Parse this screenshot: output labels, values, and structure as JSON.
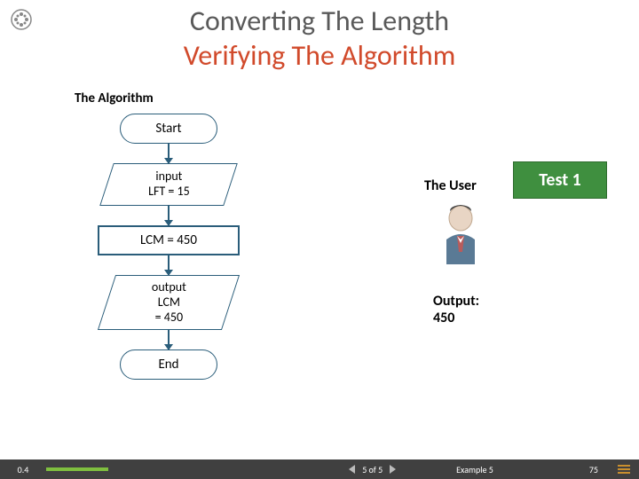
{
  "title": {
    "line1": "Converting The Length",
    "line2": "Verifying The Algorithm"
  },
  "section_label": "The Algorithm",
  "flow": {
    "start": "Start",
    "input_label": "input",
    "input_value": "LFT = 15",
    "process": "LCM = 450",
    "output_label": "output",
    "output_value1": "LCM",
    "output_value2": "= 450",
    "end": "End"
  },
  "user_label": "The User",
  "test_badge": "Test 1",
  "output": {
    "label": "Output:",
    "value": "450"
  },
  "footer": {
    "version": "0.4",
    "page": "5 of 5",
    "example": "Example 5",
    "page_num": "75"
  }
}
